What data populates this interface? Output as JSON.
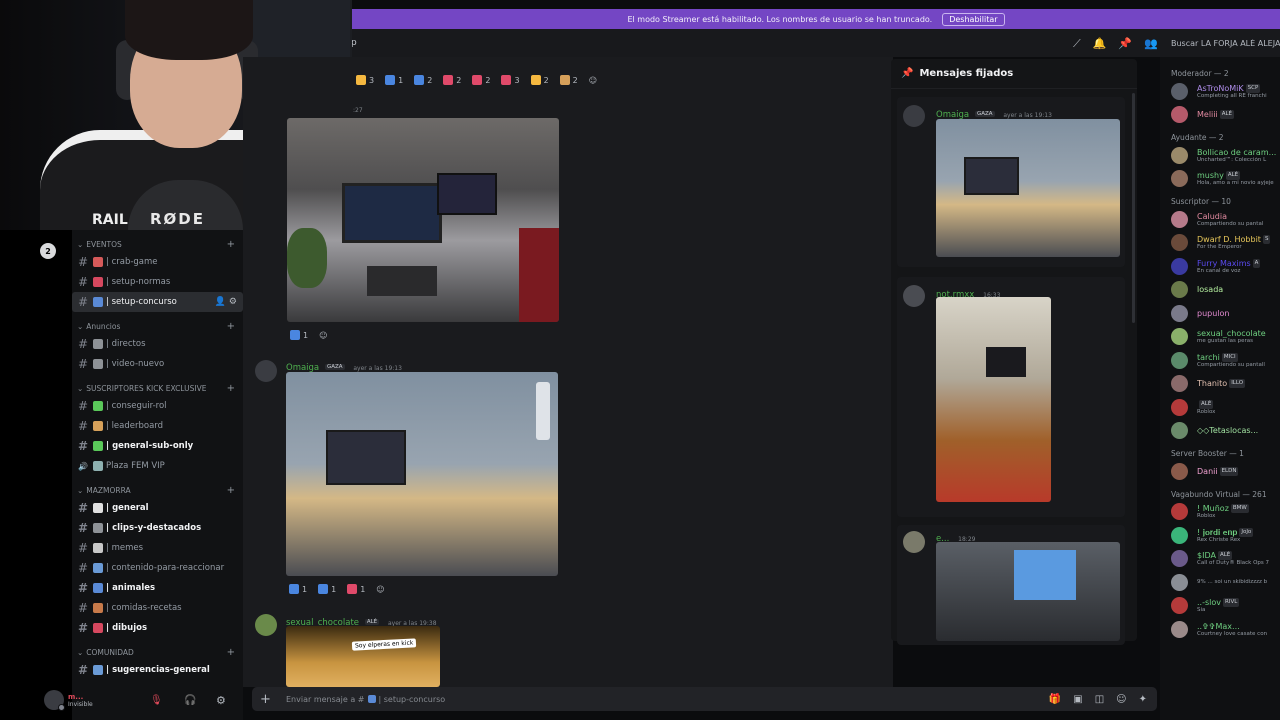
{
  "banner": {
    "text": "El modo Streamer está habilitado. Los nombres de usuario se han truncado.",
    "button": "Deshabilitar"
  },
  "topbar": {
    "channel_fragment": "p",
    "search_placeholder": "Buscar LA FORJA ALÉ ALEJAN"
  },
  "webcam": {
    "mic_brand": "RØDE",
    "shirt_text": "RAIL"
  },
  "server_icon": "2",
  "categories": [
    {
      "name": "EVENTOS",
      "channels": [
        {
          "name": "| crab-game",
          "emoji_color": "#d65a5a"
        },
        {
          "name": "| setup-normas",
          "emoji_color": "#d6485f"
        },
        {
          "name": "| setup-concurso",
          "emoji_color": "#5a8ad6",
          "selected": true
        }
      ]
    },
    {
      "name": "Anuncios",
      "channels": [
        {
          "name": "| directos",
          "emoji_color": "#8e9297"
        },
        {
          "name": "| video-nuevo",
          "emoji_color": "#8e9297"
        }
      ]
    },
    {
      "name": "SUSCRIPTORES KICK EXCLUSIVE",
      "channels": [
        {
          "name": "| conseguir-rol",
          "emoji_color": "#5ac85a"
        },
        {
          "name": "| leaderboard",
          "emoji_color": "#d6a05a"
        },
        {
          "name": "| general-sub-only",
          "emoji_color": "#5ac85a",
          "bold": true
        },
        {
          "name": "Plaza FEM VIP",
          "emoji_color": "#8eb0b0",
          "voice": true
        }
      ]
    },
    {
      "name": "MAZMORRA",
      "channels": [
        {
          "name": "| general",
          "emoji_color": "#e0e0e0",
          "bold": true
        },
        {
          "name": "| clips-y-destacados",
          "emoji_color": "#8e9297",
          "bold": true
        },
        {
          "name": "| memes",
          "emoji_color": "#c8c8c8"
        },
        {
          "name": "| contenido-para-reaccionar",
          "emoji_color": "#6a9ad6"
        },
        {
          "name": "| animales",
          "emoji_color": "#5a8ad6",
          "bold": true
        },
        {
          "name": "| comidas-recetas",
          "emoji_color": "#c87a4a"
        },
        {
          "name": "| dibujos",
          "emoji_color": "#d6485f",
          "bold": true
        }
      ]
    },
    {
      "name": "COMUNIDAD",
      "channels": [
        {
          "name": "| sugerencias-general",
          "emoji_color": "#6a9ad6",
          "bold": true
        }
      ]
    }
  ],
  "user_panel": {
    "name": "m...",
    "status": "Invisible"
  },
  "messages": {
    "reaction_bar_top": [
      {
        "c": "#f5b840",
        "n": "3"
      },
      {
        "c": "#4a86e0",
        "n": "1"
      },
      {
        "c": "#4a86e0",
        "n": "2"
      },
      {
        "c": "#e04a6a",
        "n": "2"
      },
      {
        "c": "#e04a6a",
        "n": "2"
      },
      {
        "c": "#e04a6a",
        "n": "3"
      },
      {
        "c": "#f5b840",
        "n": "2"
      },
      {
        "c": "#d6a05a",
        "n": "2"
      }
    ],
    "first_ts": ":27",
    "first_reactions": [
      {
        "c": "#4a86e0",
        "n": "1"
      }
    ],
    "m2": {
      "author": "Omaiga",
      "tag": "GAZA",
      "ts": "ayer a las 19:13",
      "reactions": [
        {
          "c": "#4a86e0",
          "n": "1"
        },
        {
          "c": "#4a86e0",
          "n": "1"
        },
        {
          "c": "#e04a6a",
          "n": "1"
        }
      ]
    },
    "m3": {
      "author": "sexual_chocolate",
      "tag": "ALÉ",
      "ts": "ayer a las 19:38",
      "image_caption": "Soy elperas en kick"
    }
  },
  "composer": {
    "placeholder_pre": "Enviar mensaje a #",
    "placeholder_post": "| setup-concurso"
  },
  "pinned": {
    "title": "Mensajes fijados",
    "items": [
      {
        "author": "Omaiga",
        "tag": "GAZA",
        "ts": "ayer a las 19:13"
      },
      {
        "author": "not.rmxx",
        "ts": "16:33"
      },
      {
        "author": "e...",
        "ts": "18:29"
      }
    ]
  },
  "members": {
    "groups": [
      {
        "label": "Moderador — 2",
        "items": [
          {
            "name": "AsTroNoMiK",
            "tag": "SCP",
            "sub": "Completing all RE franchi",
            "color": "#ae8ce8",
            "av": "#5a5f6a"
          },
          {
            "name": "Meliii",
            "tag": "ALÉ",
            "sub": "",
            "color": "#e28aa0",
            "av": "#b55a6a"
          }
        ]
      },
      {
        "label": "Ayudante — 2",
        "items": [
          {
            "name": "Bollicao de caram...",
            "tag": "",
            "sub": "Uncharted™: Colección L",
            "color": "#6fd081",
            "av": "#9a8a6a"
          },
          {
            "name": "mushy",
            "tag": "ALÉ",
            "sub": "Hola, amo a mi novio ayjeje",
            "color": "#6fd081",
            "av": "#8a6a5a"
          }
        ]
      },
      {
        "label": "Suscriptor — 10",
        "items": [
          {
            "name": "Caludia",
            "tag": "",
            "sub": "Compartiendo su pantal",
            "color": "#e28aa0",
            "av": "#b57a8a"
          },
          {
            "name": "Dwarf D. Hobbit",
            "tag": "S",
            "sub": "For the Emperor",
            "color": "#e6c65a",
            "av": "#6a4a3a"
          },
          {
            "name": "Furry Maxims",
            "tag": "A",
            "sub": "En canal de voz",
            "color": "#5a4af0",
            "av": "#3a3aa0"
          },
          {
            "name": "losada",
            "tag": "",
            "sub": "",
            "color": "#b5f0a0",
            "av": "#6a7a4a"
          },
          {
            "name": "pupulon",
            "tag": "",
            "sub": "",
            "color": "#e28ad0",
            "av": "#7a7a8a"
          },
          {
            "name": "sexual_chocolate",
            "tag": "",
            "sub": "me gustan las peras",
            "color": "#6fd081",
            "av": "#8ab06a"
          },
          {
            "name": "tarchi",
            "tag": "MICI",
            "sub": "Compartiendo su pantall",
            "color": "#6fd081",
            "av": "#5a8a6a"
          },
          {
            "name": "Thanito",
            "tag": "ILLO",
            "sub": "",
            "color": "#e2c0b0",
            "av": "#8a6a6a"
          },
          {
            "name": "",
            "tag": "ALÉ",
            "sub": "Roblox",
            "color": "#b5bac1",
            "av": "#b53a3a"
          },
          {
            "name": "◇◇Tetaslocas...",
            "tag": "",
            "sub": "",
            "color": "#a0e0a0",
            "av": "#6a8a6a"
          }
        ]
      },
      {
        "label": "Server Booster — 1",
        "items": [
          {
            "name": "Danii",
            "tag": "ELDN",
            "sub": "",
            "color": "#f0a0d0",
            "av": "#8a5a4a"
          }
        ]
      },
      {
        "label": "Vagabundo Virtual — 261",
        "items": [
          {
            "name": "! Muñoz",
            "tag": "BMW",
            "sub": "Roblox",
            "color": "#6fd081",
            "av": "#b53a3a"
          },
          {
            "name": "! 𝐣𝐨𝐫𝐝𝐢 𝐞𝐧𝐩",
            "tag": "JoJo",
            "sub": "Rex Christe Rex",
            "color": "#6fd081",
            "av": "#3ab57a"
          },
          {
            "name": "$IDA",
            "tag": "ALÉ",
            "sub": "Call of Duty® Black Ops 7",
            "color": "#6fd081",
            "av": "#6a5a8a"
          },
          {
            "name": "",
            "tag": "",
            "sub": "9% ... soi un skibidizzzz b",
            "color": "#b5bac1",
            "av": "#8a8e95"
          },
          {
            "name": "..-slov",
            "tag": "RIVL",
            "sub": "Sia",
            "color": "#6fd081",
            "av": "#b53a3a"
          },
          {
            "name": "..✞✞Max...",
            "tag": "",
            "sub": "Courtney love casate con",
            "color": "#6fd081",
            "av": "#9a8a8a"
          }
        ]
      }
    ]
  }
}
